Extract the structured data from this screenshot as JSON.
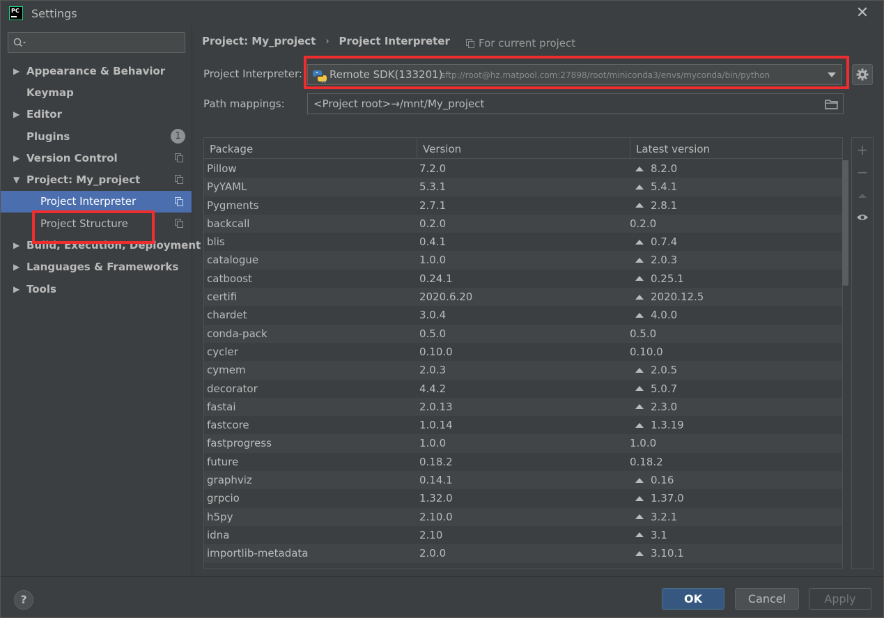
{
  "window": {
    "title": "Settings",
    "close_glyph": "✕",
    "app_logo_text": "PC"
  },
  "sidebar": {
    "search_placeholder": "",
    "items": [
      {
        "label": "Appearance & Behavior",
        "arrow": "▶",
        "bold": true
      },
      {
        "label": "Keymap",
        "arrow": "",
        "bold": true
      },
      {
        "label": "Editor",
        "arrow": "▶",
        "bold": true
      },
      {
        "label": "Plugins",
        "arrow": "",
        "bold": true,
        "badge": "1"
      },
      {
        "label": "Version Control",
        "arrow": "▶",
        "bold": true
      },
      {
        "label": "Project: My_project",
        "arrow": "▼",
        "bold": true
      },
      {
        "label": "Project Interpreter",
        "arrow": "",
        "bold": false,
        "selected": true
      },
      {
        "label": "Project Structure",
        "arrow": "",
        "bold": false
      },
      {
        "label": "Build, Execution, Deployment",
        "arrow": "▶",
        "bold": true
      },
      {
        "label": "Languages & Frameworks",
        "arrow": "▶",
        "bold": true
      },
      {
        "label": "Tools",
        "arrow": "▶",
        "bold": true
      }
    ]
  },
  "main": {
    "breadcrumb": {
      "project": "Project: My_project",
      "separator": "›",
      "page": "Project Interpreter"
    },
    "for_current_project": "For current project",
    "interpreter": {
      "label": "Project Interpreter:",
      "name": "Remote SDK(133201)",
      "path": "sftp://root@hz.matpool.com:27898/root/miniconda3/envs/myconda/bin/python"
    },
    "path_mappings": {
      "label": "Path mappings:",
      "value": "<Project root>→/mnt/My_project"
    },
    "table": {
      "headers": [
        "Package",
        "Version",
        "Latest version"
      ],
      "rows": [
        {
          "package": "Pillow",
          "version": "7.2.0",
          "latest": "8.2.0",
          "upgrade": true
        },
        {
          "package": "PyYAML",
          "version": "5.3.1",
          "latest": "5.4.1",
          "upgrade": true
        },
        {
          "package": "Pygments",
          "version": "2.7.1",
          "latest": "2.8.1",
          "upgrade": true
        },
        {
          "package": "backcall",
          "version": "0.2.0",
          "latest": "0.2.0",
          "upgrade": false
        },
        {
          "package": "blis",
          "version": "0.4.1",
          "latest": "0.7.4",
          "upgrade": true
        },
        {
          "package": "catalogue",
          "version": "1.0.0",
          "latest": "2.0.3",
          "upgrade": true
        },
        {
          "package": "catboost",
          "version": "0.24.1",
          "latest": "0.25.1",
          "upgrade": true
        },
        {
          "package": "certifi",
          "version": "2020.6.20",
          "latest": "2020.12.5",
          "upgrade": true
        },
        {
          "package": "chardet",
          "version": "3.0.4",
          "latest": "4.0.0",
          "upgrade": true
        },
        {
          "package": "conda-pack",
          "version": "0.5.0",
          "latest": "0.5.0",
          "upgrade": false
        },
        {
          "package": "cycler",
          "version": "0.10.0",
          "latest": "0.10.0",
          "upgrade": false
        },
        {
          "package": "cymem",
          "version": "2.0.3",
          "latest": "2.0.5",
          "upgrade": true
        },
        {
          "package": "decorator",
          "version": "4.4.2",
          "latest": "5.0.7",
          "upgrade": true
        },
        {
          "package": "fastai",
          "version": "2.0.13",
          "latest": "2.3.0",
          "upgrade": true
        },
        {
          "package": "fastcore",
          "version": "1.0.14",
          "latest": "1.3.19",
          "upgrade": true
        },
        {
          "package": "fastprogress",
          "version": "1.0.0",
          "latest": "1.0.0",
          "upgrade": false
        },
        {
          "package": "future",
          "version": "0.18.2",
          "latest": "0.18.2",
          "upgrade": false
        },
        {
          "package": "graphviz",
          "version": "0.14.1",
          "latest": "0.16",
          "upgrade": true
        },
        {
          "package": "grpcio",
          "version": "1.32.0",
          "latest": "1.37.0",
          "upgrade": true
        },
        {
          "package": "h5py",
          "version": "2.10.0",
          "latest": "3.2.1",
          "upgrade": true
        },
        {
          "package": "idna",
          "version": "2.10",
          "latest": "3.1",
          "upgrade": true
        },
        {
          "package": "importlib-metadata",
          "version": "2.0.0",
          "latest": "3.10.1",
          "upgrade": true
        }
      ]
    },
    "side_tools": {
      "add": "+",
      "remove": "−"
    }
  },
  "footer": {
    "help": "?",
    "ok": "OK",
    "cancel": "Cancel",
    "apply": "Apply"
  },
  "colors": {
    "selection": "#4b6eaf",
    "highlight_box": "#ee2e2e",
    "ok_button": "#365880",
    "background": "#3c3f41"
  }
}
